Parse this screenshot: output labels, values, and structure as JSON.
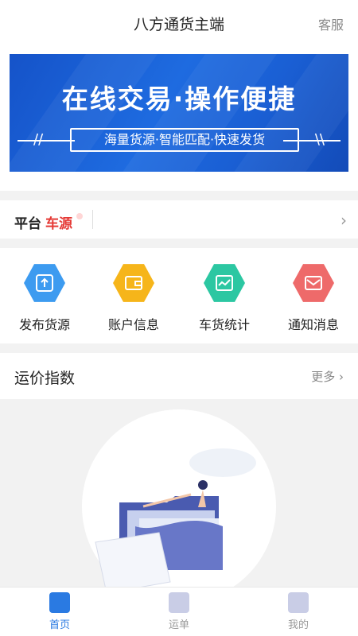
{
  "header": {
    "title": "八方通货主端",
    "service_label": "客服"
  },
  "banner": {
    "headline": "在线交易·操作便捷",
    "subline": "海量货源·智能匹配·快速发货"
  },
  "platform_bar": {
    "label_part1": "平台",
    "label_part2": "车源",
    "arrow": "›"
  },
  "shortcuts": [
    {
      "label": "发布货源",
      "icon": "upload-icon",
      "color": "#3d9bf0"
    },
    {
      "label": "账户信息",
      "icon": "wallet-icon",
      "color": "#f6b51a"
    },
    {
      "label": "车货统计",
      "icon": "chart-icon",
      "color": "#2cc7a2"
    },
    {
      "label": "通知消息",
      "icon": "mail-icon",
      "color": "#ee6a6a"
    }
  ],
  "freight_index": {
    "title": "运价指数",
    "more_label": "更多 ›"
  },
  "tabbar": {
    "items": [
      {
        "label": "首页",
        "active": true
      },
      {
        "label": "运单",
        "active": false
      },
      {
        "label": "我的",
        "active": false
      }
    ],
    "active_color": "#2a7ae2",
    "inactive_color": "#999999"
  }
}
